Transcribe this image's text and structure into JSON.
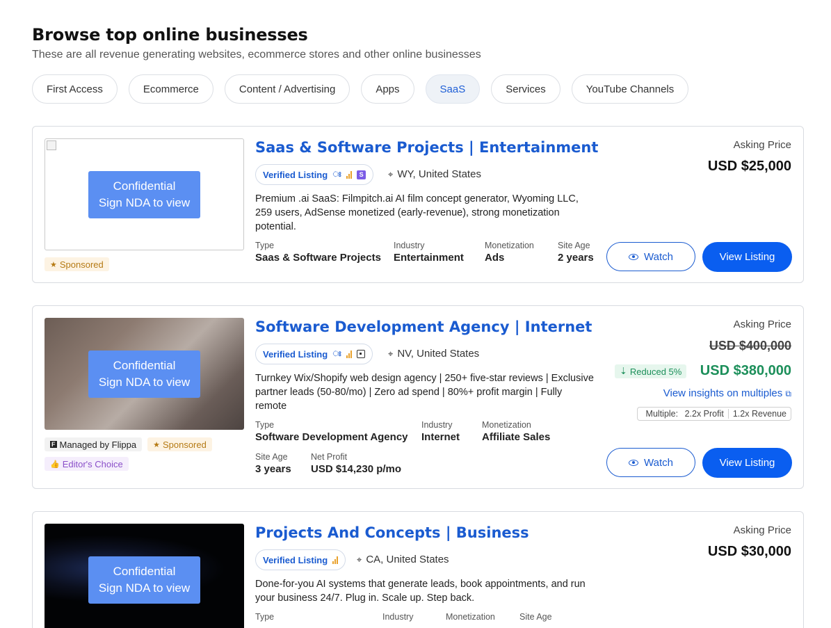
{
  "header": {
    "title": "Browse top online businesses",
    "subtitle": "These are all revenue generating websites, ecommerce stores and other online businesses"
  },
  "categories": [
    {
      "label": "First Access",
      "active": false
    },
    {
      "label": "Ecommerce",
      "active": false
    },
    {
      "label": "Content / Advertising",
      "active": false
    },
    {
      "label": "Apps",
      "active": false
    },
    {
      "label": "SaaS",
      "active": true
    },
    {
      "label": "Services",
      "active": false
    },
    {
      "label": "YouTube Channels",
      "active": false
    }
  ],
  "listings": [
    {
      "thumbnail": {
        "line1": "Confidential",
        "line2": "Sign NDA to view"
      },
      "badges": {
        "sponsored": "Sponsored"
      },
      "title": "Saas & Software Projects | Entertainment",
      "verified": "Verified Listing",
      "location": "WY, United States",
      "description": "Premium .ai SaaS: Filmpitch.ai AI film concept generator, Wyoming LLC, 259 users, AdSense monetized (early-revenue), strong monetization potential.",
      "facts": {
        "type_label": "Type",
        "type": "Saas & Software Projects",
        "industry_label": "Industry",
        "industry": "Entertainment",
        "monetization_label": "Monetization",
        "monetization": "Ads",
        "age_label": "Site Age",
        "age": "2 years"
      },
      "asking_label": "Asking Price",
      "price": "USD $25,000",
      "watch": "Watch",
      "view": "View Listing"
    },
    {
      "thumbnail": {
        "line1": "Confidential",
        "line2": "Sign NDA to view"
      },
      "badges": {
        "managed": "Managed by Flippa",
        "sponsored": "Sponsored",
        "editor": "Editor's Choice"
      },
      "title": "Software Development Agency | Internet",
      "verified": "Verified Listing",
      "location": "NV, United States",
      "description": "Turnkey Wix/Shopify web design agency | 250+ five-star reviews | Exclusive partner leads (50-80/mo) | Zero ad spend | 80%+ profit margin | Fully remote",
      "facts": {
        "type_label": "Type",
        "type": "Software Development Agency",
        "industry_label": "Industry",
        "industry": "Internet",
        "monetization_label": "Monetization",
        "monetization": "Affiliate Sales",
        "age_label": "Site Age",
        "age": "3 years",
        "profit_label": "Net Profit",
        "profit": "USD $14,230 p/mo"
      },
      "asking_label": "Asking Price",
      "old_price": "USD $400,000",
      "reduced": "Reduced 5%",
      "price": "USD $380,000",
      "insights": "View insights on multiples",
      "multiples": {
        "label": "Multiple:",
        "profit": "2.2x Profit",
        "revenue": "1.2x Revenue"
      },
      "watch": "Watch",
      "view": "View Listing"
    },
    {
      "thumbnail": {
        "line1": "Confidential",
        "line2": "Sign NDA to view"
      },
      "title": "Projects And Concepts | Business",
      "verified": "Verified Listing",
      "location": "CA, United States",
      "description": "Done-for-you AI systems that generate leads, book appointments, and run your business 24/7. Plug in. Scale up. Step back.",
      "facts": {
        "type_label": "Type",
        "industry_label": "Industry",
        "monetization_label": "Monetization",
        "age_label": "Site Age"
      },
      "asking_label": "Asking Price",
      "price": "USD $30,000"
    }
  ],
  "icons": {
    "location": "map-pin-icon",
    "watch": "eye-icon",
    "external": "external-link-icon",
    "sponsored": "star-icon",
    "editor": "thumbs-up-icon",
    "managed": "flippa-logo-icon"
  },
  "colors": {
    "accent": "#0a5ef0",
    "link": "#1a5bd0",
    "reduced": "#1c8f5a",
    "sponsored": "#b57a14",
    "editor": "#8a4fc9"
  }
}
